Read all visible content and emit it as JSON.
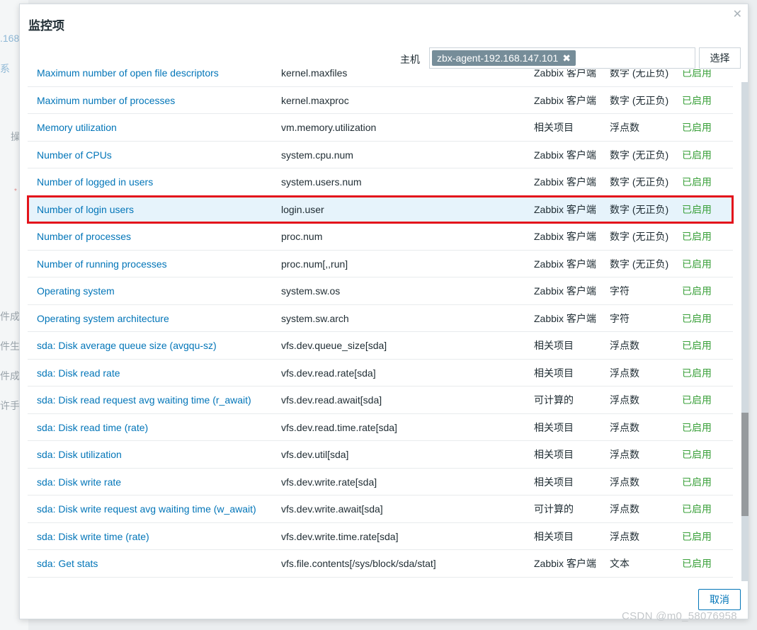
{
  "background": {
    "fragments": [
      ".168",
      "系",
      "操",
      "*",
      "件成",
      "件生",
      "件成",
      "许手"
    ]
  },
  "dialog": {
    "title": "监控项",
    "close_icon": "close-icon",
    "host_label": "主机",
    "host_value": "zbx-agent-192.168.147.101",
    "select_label": "选择",
    "cancel_label": "取消"
  },
  "items": [
    {
      "name": "Maximum number of open file descriptors",
      "key": "kernel.maxfiles",
      "type": "Zabbix 客户端",
      "value_type": "数字 (无正负)",
      "status": "已启用"
    },
    {
      "name": "Maximum number of processes",
      "key": "kernel.maxproc",
      "type": "Zabbix 客户端",
      "value_type": "数字 (无正负)",
      "status": "已启用"
    },
    {
      "name": "Memory utilization",
      "key": "vm.memory.utilization",
      "type": "相关项目",
      "value_type": "浮点数",
      "status": "已启用"
    },
    {
      "name": "Number of CPUs",
      "key": "system.cpu.num",
      "type": "Zabbix 客户端",
      "value_type": "数字 (无正负)",
      "status": "已启用"
    },
    {
      "name": "Number of logged in users",
      "key": "system.users.num",
      "type": "Zabbix 客户端",
      "value_type": "数字 (无正负)",
      "status": "已启用"
    },
    {
      "name": "Number of login users",
      "key": "login.user",
      "type": "Zabbix 客户端",
      "value_type": "数字 (无正负)",
      "status": "已启用",
      "highlighted": true
    },
    {
      "name": "Number of processes",
      "key": "proc.num",
      "type": "Zabbix 客户端",
      "value_type": "数字 (无正负)",
      "status": "已启用"
    },
    {
      "name": "Number of running processes",
      "key": "proc.num[,,run]",
      "type": "Zabbix 客户端",
      "value_type": "数字 (无正负)",
      "status": "已启用"
    },
    {
      "name": "Operating system",
      "key": "system.sw.os",
      "type": "Zabbix 客户端",
      "value_type": "字符",
      "status": "已启用"
    },
    {
      "name": "Operating system architecture",
      "key": "system.sw.arch",
      "type": "Zabbix 客户端",
      "value_type": "字符",
      "status": "已启用"
    },
    {
      "name": "sda: Disk average queue size (avgqu-sz)",
      "key": "vfs.dev.queue_size[sda]",
      "type": "相关项目",
      "value_type": "浮点数",
      "status": "已启用"
    },
    {
      "name": "sda: Disk read rate",
      "key": "vfs.dev.read.rate[sda]",
      "type": "相关项目",
      "value_type": "浮点数",
      "status": "已启用"
    },
    {
      "name": "sda: Disk read request avg waiting time (r_await)",
      "key": "vfs.dev.read.await[sda]",
      "type": "可计算的",
      "value_type": "浮点数",
      "status": "已启用"
    },
    {
      "name": "sda: Disk read time (rate)",
      "key": "vfs.dev.read.time.rate[sda]",
      "type": "相关项目",
      "value_type": "浮点数",
      "status": "已启用"
    },
    {
      "name": "sda: Disk utilization",
      "key": "vfs.dev.util[sda]",
      "type": "相关项目",
      "value_type": "浮点数",
      "status": "已启用"
    },
    {
      "name": "sda: Disk write rate",
      "key": "vfs.dev.write.rate[sda]",
      "type": "相关项目",
      "value_type": "浮点数",
      "status": "已启用"
    },
    {
      "name": "sda: Disk write request avg waiting time (w_await)",
      "key": "vfs.dev.write.await[sda]",
      "type": "可计算的",
      "value_type": "浮点数",
      "status": "已启用"
    },
    {
      "name": "sda: Disk write time (rate)",
      "key": "vfs.dev.write.time.rate[sda]",
      "type": "相关项目",
      "value_type": "浮点数",
      "status": "已启用"
    },
    {
      "name": "sda: Get stats",
      "key": "vfs.file.contents[/sys/block/sda/stat]",
      "type": "Zabbix 客户端",
      "value_type": "文本",
      "status": "已启用"
    }
  ],
  "watermark": "CSDN @m0_58076958",
  "colors": {
    "link": "#0275b8",
    "enabled": "#3aa03a",
    "highlight_border": "#e3131b",
    "chip": "#768d99"
  }
}
